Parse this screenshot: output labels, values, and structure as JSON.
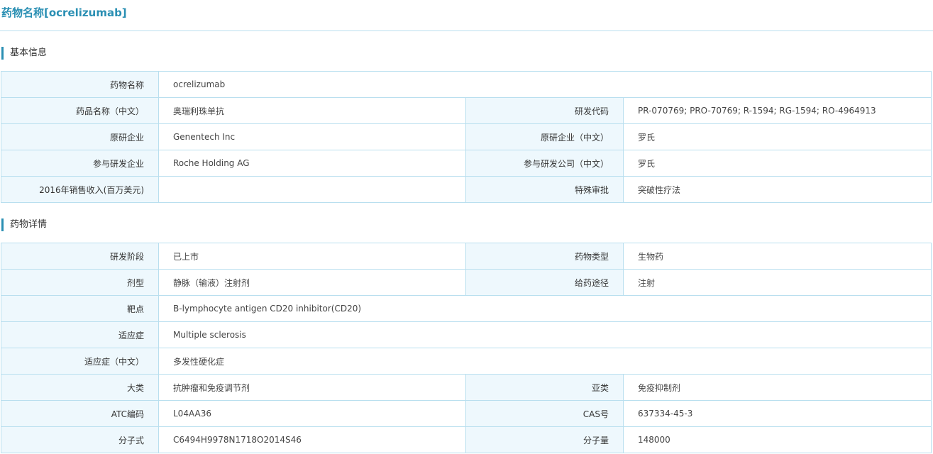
{
  "page_title": "药物名称[ocrelizumab]",
  "sections": {
    "basic": {
      "heading": "基本信息",
      "rows": [
        {
          "l1": "药物名称",
          "v1": "ocrelizumab"
        },
        {
          "l1": "药品名称（中文）",
          "v1": "奥瑞利珠单抗",
          "l2": "研发代码",
          "v2": "PR-070769; PRO-70769; R-1594; RG-1594; RO-4964913"
        },
        {
          "l1": "原研企业",
          "v1": "Genentech Inc",
          "l2": "原研企业（中文）",
          "v2": "罗氏"
        },
        {
          "l1": "参与研发企业",
          "v1": "Roche Holding AG",
          "l2": "参与研发公司（中文）",
          "v2": "罗氏"
        },
        {
          "l1": "2016年销售收入(百万美元)",
          "v1": "",
          "l2": "特殊审批",
          "v2": "突破性疗法"
        }
      ]
    },
    "detail": {
      "heading": "药物详情",
      "rows": [
        {
          "l1": "研发阶段",
          "v1": "已上市",
          "l2": "药物类型",
          "v2": "生物药"
        },
        {
          "l1": "剂型",
          "v1": "静脉（输液）注射剂",
          "l2": "给药途径",
          "v2": "注射"
        },
        {
          "l1": "靶点",
          "v1": "B-lymphocyte antigen CD20 inhibitor(CD20)"
        },
        {
          "l1": "适应症",
          "v1": "Multiple sclerosis"
        },
        {
          "l1": "适应症（中文）",
          "v1": "多发性硬化症"
        },
        {
          "l1": "大类",
          "v1": "抗肿瘤和免疫调节剂",
          "l2": "亚类",
          "v2": "免疫抑制剂"
        },
        {
          "l1": "ATC编码",
          "v1": "L04AA36",
          "l2": "CAS号",
          "v2": "637334-45-3"
        },
        {
          "l1": "分子式",
          "v1": "C6494H9978N1718O2014S46",
          "l2": "分子量",
          "v2": "148000"
        }
      ]
    }
  },
  "colors": {
    "accent": "#2a8fb3",
    "border": "#b9dfef",
    "label_bg": "#eef8fd"
  }
}
